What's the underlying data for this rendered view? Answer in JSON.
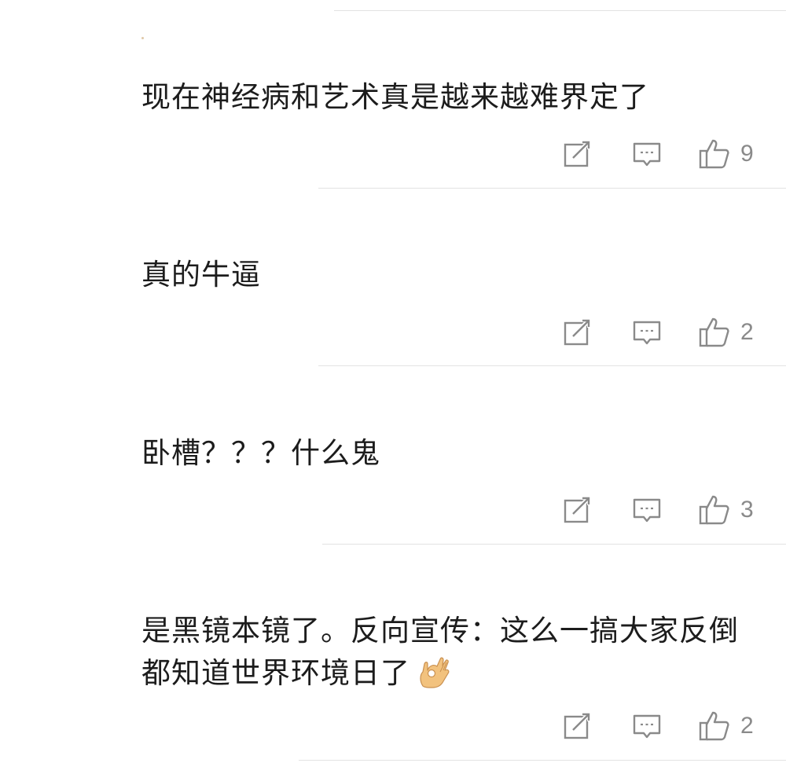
{
  "comments": [
    {
      "text": "现在神经病和艺术真是越来越难界定了",
      "likes": "9"
    },
    {
      "text": "真的牛逼",
      "likes": "2"
    },
    {
      "text": "卧槽？？？什么鬼",
      "likes": "3"
    },
    {
      "text": "是黑镜本镜了。反向宣传：这么一搞大家反倒都知道世界环境日了",
      "likes": "2",
      "emoji": "ok-hand-emoji"
    }
  ],
  "icons": {
    "share": "share-icon",
    "reply": "comment-icon",
    "like": "thumbs-up-icon"
  },
  "colors": {
    "text": "#1c1c1c",
    "icon": "#8a8a8a",
    "divider": "#e3e3e3",
    "emoji": "#f2c27e"
  }
}
